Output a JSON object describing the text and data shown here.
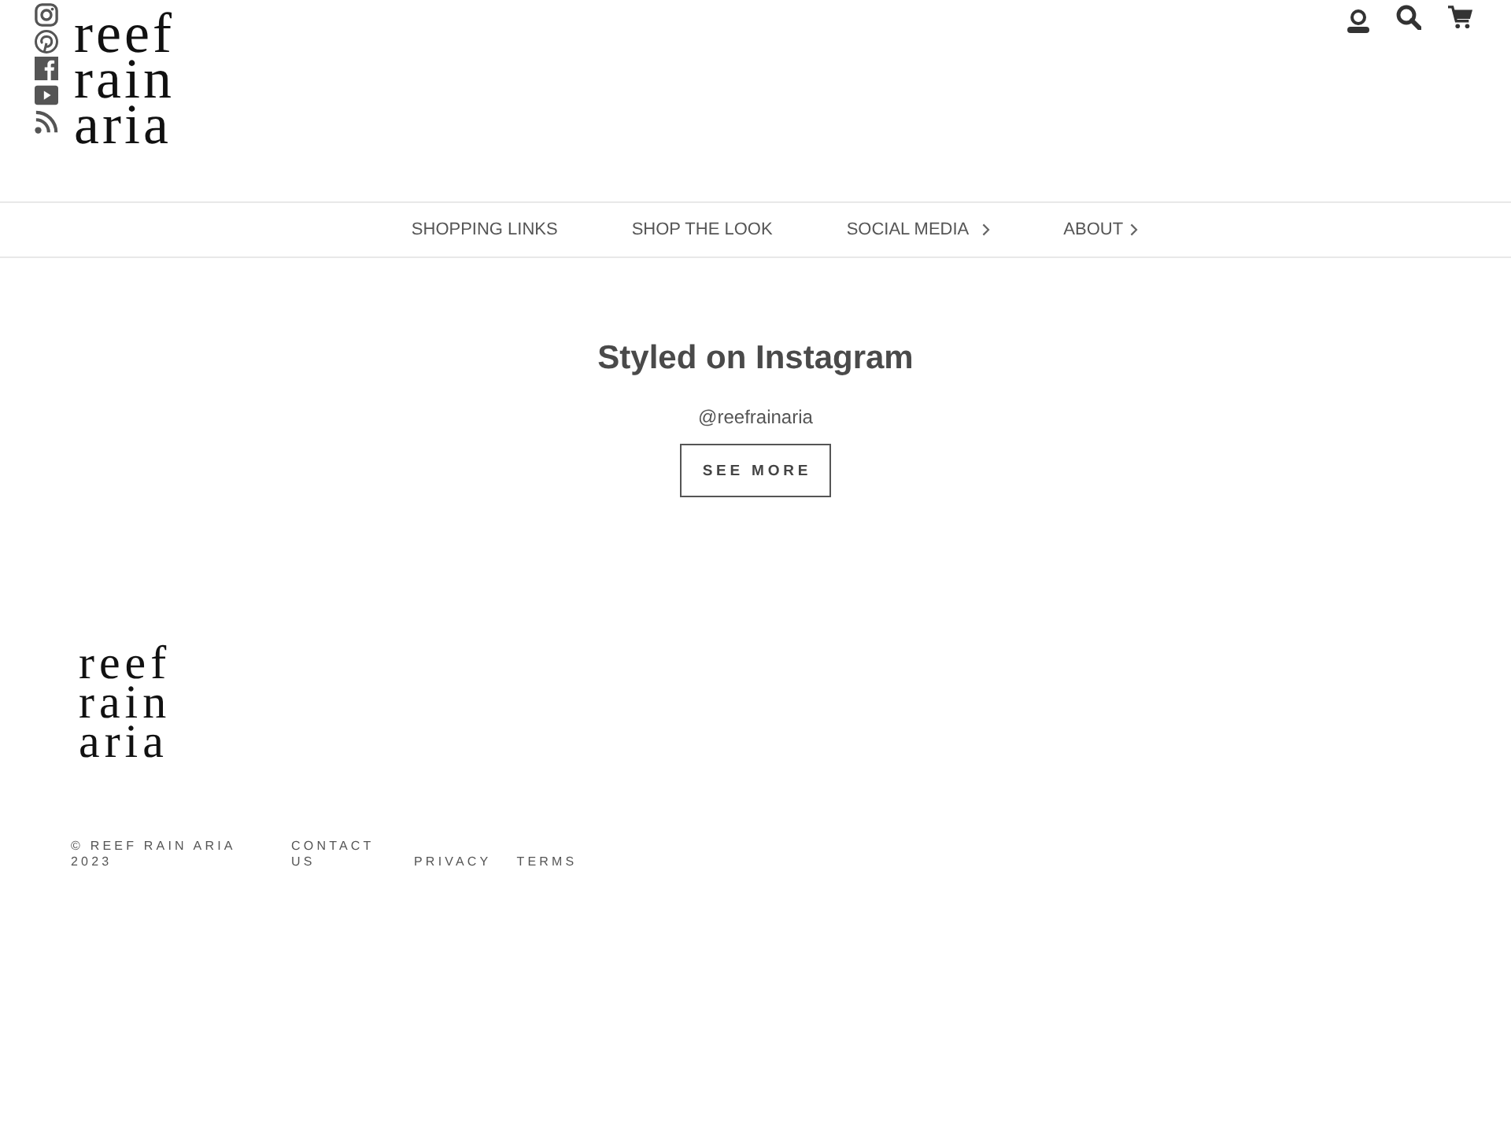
{
  "header": {
    "logo": "reef rain aria"
  },
  "nav": [
    {
      "label": "SHOPPING LINKS",
      "has_submenu": false
    },
    {
      "label": "SHOP THE LOOK",
      "has_submenu": false
    },
    {
      "label": "SOCIAL MEDIA",
      "has_submenu": true
    },
    {
      "label": "ABOUT",
      "has_submenu": true
    }
  ],
  "instagram_section": {
    "title": "Styled on Instagram",
    "handle": "@reefrainaria",
    "button": "SEE MORE"
  },
  "footer": {
    "logo": "reef rain aria",
    "copyright": "© REEF RAIN ARIA 2023",
    "links": [
      "CONTACT US",
      "PRIVACY",
      "TERMS"
    ]
  }
}
